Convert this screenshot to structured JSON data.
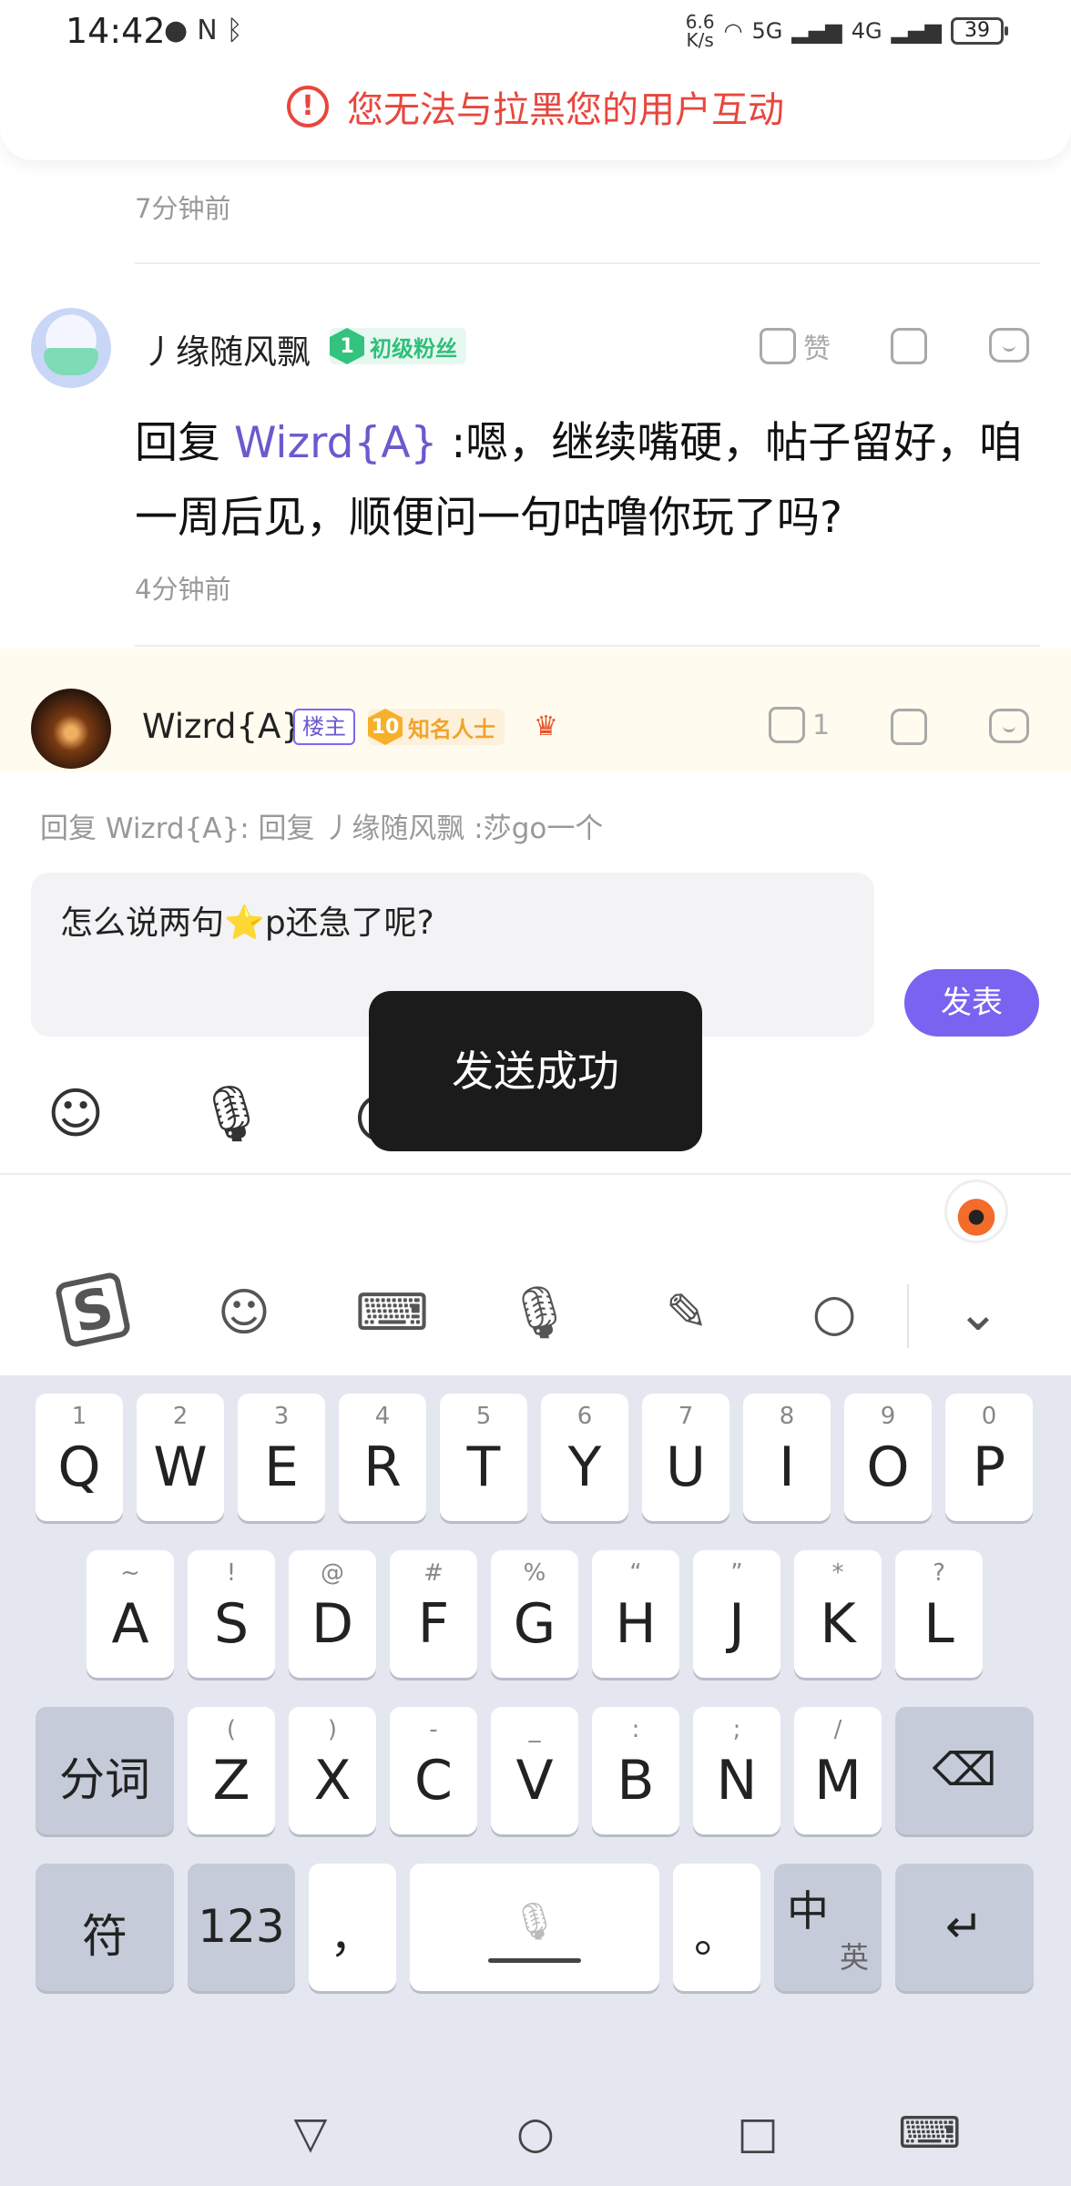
{
  "status": {
    "time": "14:42",
    "left_icons": [
      "message-icon",
      "nfc-icon",
      "bluetooth-icon"
    ],
    "netspeed_value": "6.6",
    "netspeed_unit": "K/s",
    "net1": "5G",
    "net2": "4G",
    "battery": "39"
  },
  "notice": {
    "text": "您无法与拉黑您的用户互动",
    "icon": "!",
    "color": "#e8463d"
  },
  "comments": [
    {
      "time": "7分钟前"
    },
    {
      "username": "丿缘随风飘",
      "fan_level": "1",
      "fan_badge": "初级粉丝",
      "like_label": "赞",
      "reply_prefix": "回复",
      "mention": "Wizrd{A}",
      "text": " :嗯，继续嘴硬，帖子留好，咱一周后见，顺便问一句咕噜你玩了吗?",
      "time": "4分钟前"
    },
    {
      "username": "Wizrd{A}",
      "host_badge": "楼主",
      "fan_level": "10",
      "fan_badge": "知名人士",
      "like_count": "1"
    }
  ],
  "composer": {
    "reply_hint": "回复 Wizrd{A}:  回复 丿缘随风飘  :莎go一个",
    "input_value": "怎么说两句⭐p还急了呢?",
    "post_label": "发表",
    "accent": "#7a63f0"
  },
  "toast": {
    "text": "发送成功"
  },
  "keyboard": {
    "row1": [
      {
        "sub": "1",
        "key": "Q"
      },
      {
        "sub": "2",
        "key": "W"
      },
      {
        "sub": "3",
        "key": "E"
      },
      {
        "sub": "4",
        "key": "R"
      },
      {
        "sub": "5",
        "key": "T"
      },
      {
        "sub": "6",
        "key": "Y"
      },
      {
        "sub": "7",
        "key": "U"
      },
      {
        "sub": "8",
        "key": "I"
      },
      {
        "sub": "9",
        "key": "O"
      },
      {
        "sub": "0",
        "key": "P"
      }
    ],
    "row2": [
      {
        "sub": "~",
        "key": "A"
      },
      {
        "sub": "!",
        "key": "S"
      },
      {
        "sub": "@",
        "key": "D"
      },
      {
        "sub": "#",
        "key": "F"
      },
      {
        "sub": "%",
        "key": "G"
      },
      {
        "sub": "“",
        "key": "H"
      },
      {
        "sub": "”",
        "key": "J"
      },
      {
        "sub": "*",
        "key": "K"
      },
      {
        "sub": "?",
        "key": "L"
      }
    ],
    "row3": [
      {
        "sub": "(",
        "key": "Z"
      },
      {
        "sub": ")",
        "key": "X"
      },
      {
        "sub": "-",
        "key": "C"
      },
      {
        "sub": "_",
        "key": "V"
      },
      {
        "sub": ":",
        "key": "B"
      },
      {
        "sub": ";",
        "key": "N"
      },
      {
        "sub": "/",
        "key": "M"
      }
    ],
    "segment_label": "分词",
    "symbol_label": "符",
    "numeric_label": "123",
    "comma_label": "，",
    "period_label": "。",
    "lang_main": "中",
    "lang_sub": "英"
  }
}
